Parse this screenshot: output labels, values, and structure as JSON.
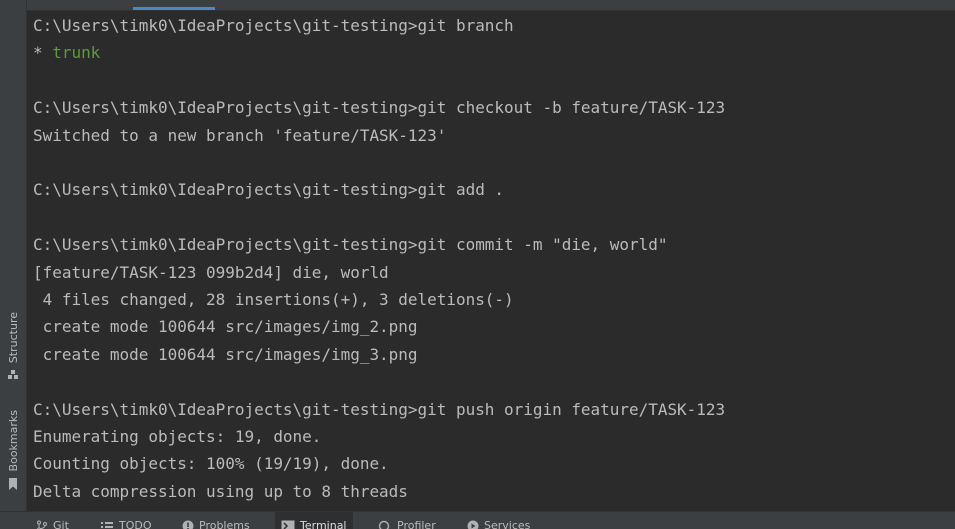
{
  "terminal": {
    "lines": [
      {
        "parts": [
          {
            "text": "C:\\Users\\timk0\\IdeaProjects\\git-testing>git branch"
          }
        ]
      },
      {
        "parts": [
          {
            "text": "* "
          },
          {
            "text": "trunk",
            "color": "green"
          }
        ]
      },
      {
        "parts": [
          {
            "text": ""
          }
        ]
      },
      {
        "parts": [
          {
            "text": "C:\\Users\\timk0\\IdeaProjects\\git-testing>git checkout -b feature/TASK-123"
          }
        ]
      },
      {
        "parts": [
          {
            "text": "Switched to a new branch 'feature/TASK-123'"
          }
        ]
      },
      {
        "parts": [
          {
            "text": ""
          }
        ]
      },
      {
        "parts": [
          {
            "text": "C:\\Users\\timk0\\IdeaProjects\\git-testing>git add ."
          }
        ]
      },
      {
        "parts": [
          {
            "text": ""
          }
        ]
      },
      {
        "parts": [
          {
            "text": "C:\\Users\\timk0\\IdeaProjects\\git-testing>git commit -m \"die, world\""
          }
        ]
      },
      {
        "parts": [
          {
            "text": "[feature/TASK-123 099b2d4] die, world"
          }
        ]
      },
      {
        "parts": [
          {
            "text": " 4 files changed, 28 insertions(+), 3 deletions(-)"
          }
        ]
      },
      {
        "parts": [
          {
            "text": " create mode 100644 src/images/img_2.png"
          }
        ]
      },
      {
        "parts": [
          {
            "text": " create mode 100644 src/images/img_3.png"
          }
        ]
      },
      {
        "parts": [
          {
            "text": ""
          }
        ]
      },
      {
        "parts": [
          {
            "text": "C:\\Users\\timk0\\IdeaProjects\\git-testing>git push origin feature/TASK-123"
          }
        ]
      },
      {
        "parts": [
          {
            "text": "Enumerating objects: 19, done."
          }
        ]
      },
      {
        "parts": [
          {
            "text": "Counting objects: 100% (19/19), done."
          }
        ]
      },
      {
        "parts": [
          {
            "text": "Delta compression using up to 8 threads"
          }
        ]
      }
    ]
  },
  "left_tools": {
    "structure_label": "Structure",
    "bookmarks_label": "Bookmarks"
  },
  "bottom_tabs": [
    {
      "label": "Git",
      "icon": "git-branch-icon",
      "active": false
    },
    {
      "label": "TODO",
      "icon": "list-icon",
      "active": false
    },
    {
      "label": "Problems",
      "icon": "problems-icon",
      "active": false
    },
    {
      "label": "Terminal",
      "icon": "terminal-icon",
      "active": true
    },
    {
      "label": "Profiler",
      "icon": "profiler-icon",
      "active": false
    },
    {
      "label": "Services",
      "icon": "services-icon",
      "active": false
    }
  ],
  "colors": {
    "background": "#2b2b2b",
    "text": "#bbbbbb",
    "branch_green": "#5d9b3c",
    "accent": "#4a88c7"
  }
}
